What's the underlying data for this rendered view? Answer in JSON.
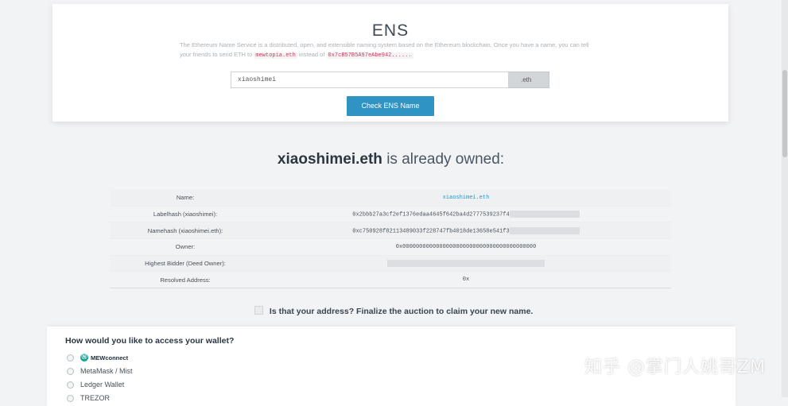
{
  "ens": {
    "title": "ENS",
    "desc_line1": "The Ethereum Name Service is a distributed, open, and extensible naming system based on the Ethereum blockchain. Once you have a name, you",
    "desc_line2_prefix": "can tell your friends to send ETH to",
    "desc_example_name": "mewtopia.eth",
    "desc_line2_middle": "instead of",
    "desc_example_address": "0x7cB57B5A97eAbe942......",
    "input_value": "xiaoshimei",
    "tld": ".eth",
    "check_button": "Check ENS Name"
  },
  "owned": {
    "name": "xiaoshimei.eth",
    "suffix": "is already owned:"
  },
  "details": [
    {
      "key": "Name:",
      "value": "xiaoshimei.eth",
      "link": true,
      "redacted": false
    },
    {
      "key": "Labelhash (xiaoshimei):",
      "value": "0x2bbb27a3cf2ef1376edaa4645f642ba4d2777539237f4",
      "link": false,
      "redacted": true
    },
    {
      "key": "Namehash (xiaoshimei.eth):",
      "value": "0xc750928f82113489033f228747fb4018de13658e541f3",
      "link": false,
      "redacted": true
    },
    {
      "key": "Owner:",
      "value": "0x0000000000000000000000000000000000000000",
      "link": false,
      "redacted": false
    },
    {
      "key": "Highest Bidder (Deed Owner):",
      "value": "",
      "link": false,
      "redacted": "full"
    },
    {
      "key": "Resolved Address:",
      "value": "0x",
      "link": false,
      "redacted": false
    }
  ],
  "finalize_text": "Is that your address? Finalize the auction to claim your new name.",
  "wallet": {
    "heading": "How would you like to access your wallet?",
    "options": [
      "MEWconnect",
      "MetaMask / Mist",
      "Ledger Wallet",
      "TREZOR"
    ]
  },
  "watermark": "知乎 @掌门人姚哥ZM",
  "colors": {
    "accent": "#2f94c3",
    "code": "#cf3a5a",
    "mew": "#0fa391"
  }
}
